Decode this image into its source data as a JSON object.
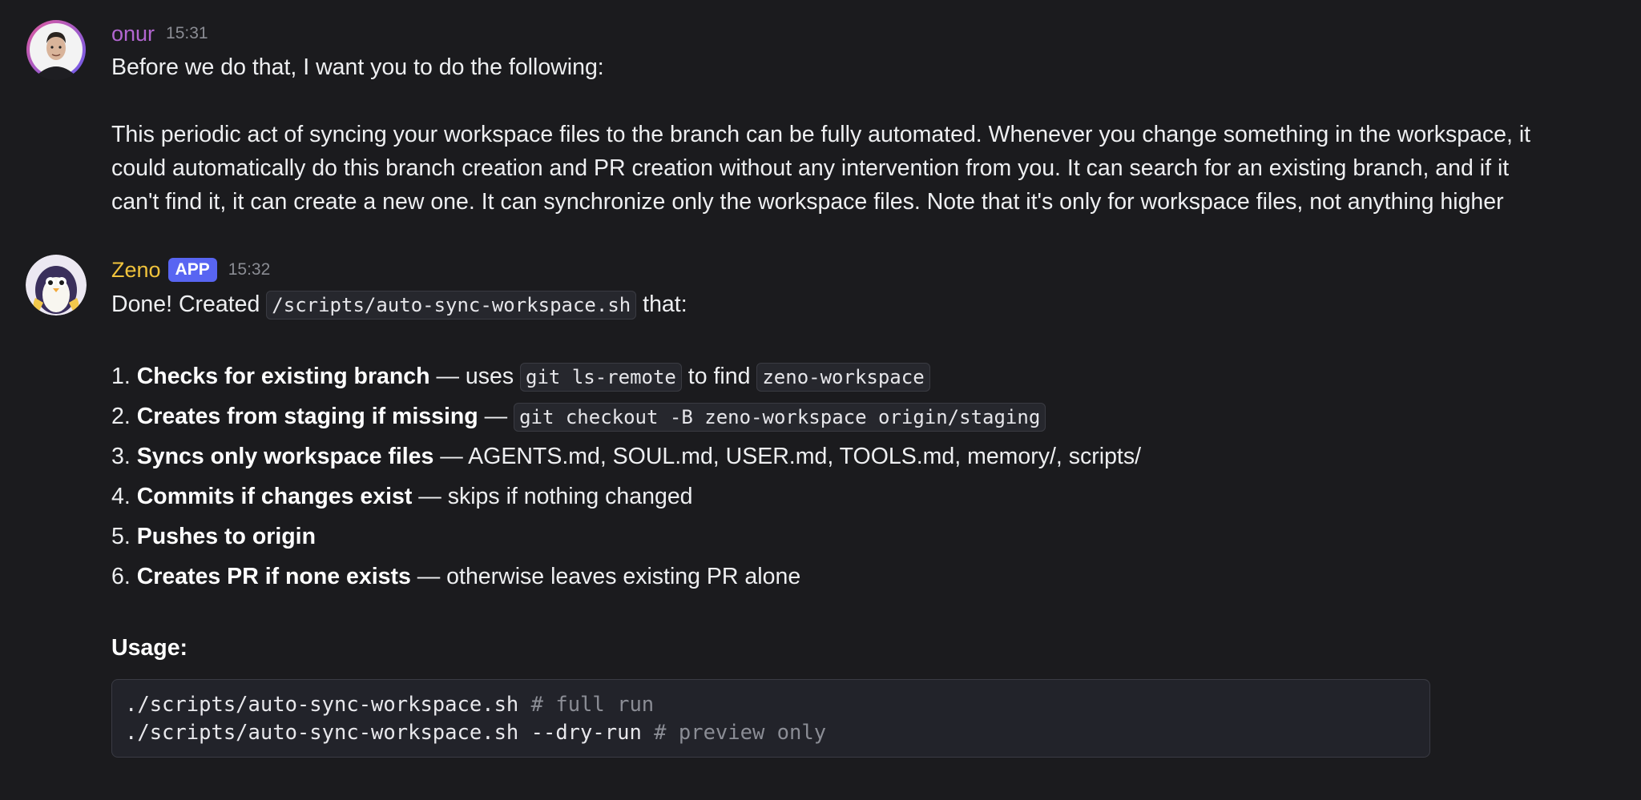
{
  "messages": [
    {
      "username": "onur",
      "username_color": "#b266d0",
      "timestamp": "15:31",
      "lines": [
        "Before we do that, I want you to do the following:",
        "This periodic act of syncing your workspace files to the branch can be fully automated. Whenever you change something in the workspace, it",
        "could automatically do this branch creation and PR creation without any intervention from you. It can search for an existing branch, and if it",
        "can't find it, it can create a new one. It can synchronize only the workspace files. Note that it's only for workspace files, not anything higher"
      ]
    },
    {
      "username": "Zeno",
      "username_color": "#f0c33c",
      "badge": "APP",
      "timestamp": "15:32",
      "intro_before": "Done! Created",
      "intro_code": "/scripts/auto-sync-workspace.sh",
      "intro_after": "that:",
      "list": [
        {
          "num": "1.",
          "bold": "Checks for existing branch",
          "sep": " — uses ",
          "code1": "git ls-remote",
          "mid": " to find ",
          "code2": "zeno-workspace"
        },
        {
          "num": "2.",
          "bold": "Creates from staging if missing",
          "sep": " — ",
          "code1": "git checkout -B zeno-workspace origin/staging"
        },
        {
          "num": "3.",
          "bold": "Syncs only workspace files",
          "rest": " — AGENTS.md, SOUL.md, USER.md, TOOLS.md, memory/, scripts/"
        },
        {
          "num": "4.",
          "bold": "Commits if changes exist",
          "rest": " — skips if nothing changed"
        },
        {
          "num": "5.",
          "bold": "Pushes to origin"
        },
        {
          "num": "6.",
          "bold": "Creates PR if none exists",
          "rest": " — otherwise leaves existing PR alone"
        }
      ],
      "usage_label": "Usage:",
      "code_lines": [
        {
          "cmd": "./scripts/auto-sync-workspace.sh ",
          "comment": "# full run"
        },
        {
          "cmd": "./scripts/auto-sync-workspace.sh --dry-run ",
          "comment": "# preview only"
        }
      ]
    }
  ]
}
